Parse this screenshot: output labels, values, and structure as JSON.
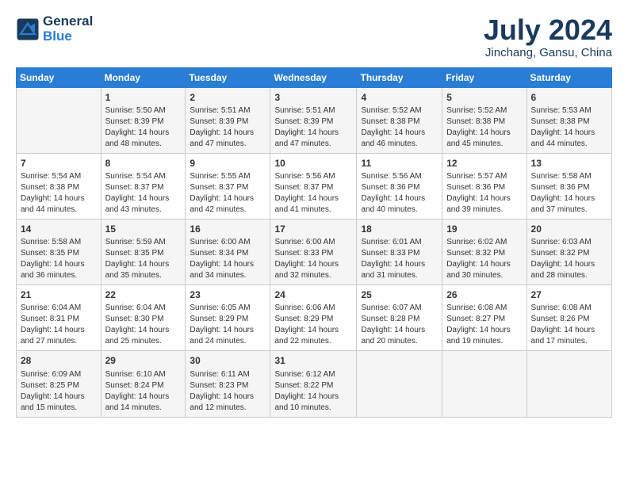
{
  "logo": {
    "line1": "General",
    "line2": "Blue"
  },
  "title": "July 2024",
  "location": "Jinchang, Gansu, China",
  "weekdays": [
    "Sunday",
    "Monday",
    "Tuesday",
    "Wednesday",
    "Thursday",
    "Friday",
    "Saturday"
  ],
  "weeks": [
    [
      {
        "day": "",
        "info": ""
      },
      {
        "day": "1",
        "info": "Sunrise: 5:50 AM\nSunset: 8:39 PM\nDaylight: 14 hours\nand 48 minutes."
      },
      {
        "day": "2",
        "info": "Sunrise: 5:51 AM\nSunset: 8:39 PM\nDaylight: 14 hours\nand 47 minutes."
      },
      {
        "day": "3",
        "info": "Sunrise: 5:51 AM\nSunset: 8:39 PM\nDaylight: 14 hours\nand 47 minutes."
      },
      {
        "day": "4",
        "info": "Sunrise: 5:52 AM\nSunset: 8:38 PM\nDaylight: 14 hours\nand 46 minutes."
      },
      {
        "day": "5",
        "info": "Sunrise: 5:52 AM\nSunset: 8:38 PM\nDaylight: 14 hours\nand 45 minutes."
      },
      {
        "day": "6",
        "info": "Sunrise: 5:53 AM\nSunset: 8:38 PM\nDaylight: 14 hours\nand 44 minutes."
      }
    ],
    [
      {
        "day": "7",
        "info": "Sunrise: 5:54 AM\nSunset: 8:38 PM\nDaylight: 14 hours\nand 44 minutes."
      },
      {
        "day": "8",
        "info": "Sunrise: 5:54 AM\nSunset: 8:37 PM\nDaylight: 14 hours\nand 43 minutes."
      },
      {
        "day": "9",
        "info": "Sunrise: 5:55 AM\nSunset: 8:37 PM\nDaylight: 14 hours\nand 42 minutes."
      },
      {
        "day": "10",
        "info": "Sunrise: 5:56 AM\nSunset: 8:37 PM\nDaylight: 14 hours\nand 41 minutes."
      },
      {
        "day": "11",
        "info": "Sunrise: 5:56 AM\nSunset: 8:36 PM\nDaylight: 14 hours\nand 40 minutes."
      },
      {
        "day": "12",
        "info": "Sunrise: 5:57 AM\nSunset: 8:36 PM\nDaylight: 14 hours\nand 39 minutes."
      },
      {
        "day": "13",
        "info": "Sunrise: 5:58 AM\nSunset: 8:36 PM\nDaylight: 14 hours\nand 37 minutes."
      }
    ],
    [
      {
        "day": "14",
        "info": "Sunrise: 5:58 AM\nSunset: 8:35 PM\nDaylight: 14 hours\nand 36 minutes."
      },
      {
        "day": "15",
        "info": "Sunrise: 5:59 AM\nSunset: 8:35 PM\nDaylight: 14 hours\nand 35 minutes."
      },
      {
        "day": "16",
        "info": "Sunrise: 6:00 AM\nSunset: 8:34 PM\nDaylight: 14 hours\nand 34 minutes."
      },
      {
        "day": "17",
        "info": "Sunrise: 6:00 AM\nSunset: 8:33 PM\nDaylight: 14 hours\nand 32 minutes."
      },
      {
        "day": "18",
        "info": "Sunrise: 6:01 AM\nSunset: 8:33 PM\nDaylight: 14 hours\nand 31 minutes."
      },
      {
        "day": "19",
        "info": "Sunrise: 6:02 AM\nSunset: 8:32 PM\nDaylight: 14 hours\nand 30 minutes."
      },
      {
        "day": "20",
        "info": "Sunrise: 6:03 AM\nSunset: 8:32 PM\nDaylight: 14 hours\nand 28 minutes."
      }
    ],
    [
      {
        "day": "21",
        "info": "Sunrise: 6:04 AM\nSunset: 8:31 PM\nDaylight: 14 hours\nand 27 minutes."
      },
      {
        "day": "22",
        "info": "Sunrise: 6:04 AM\nSunset: 8:30 PM\nDaylight: 14 hours\nand 25 minutes."
      },
      {
        "day": "23",
        "info": "Sunrise: 6:05 AM\nSunset: 8:29 PM\nDaylight: 14 hours\nand 24 minutes."
      },
      {
        "day": "24",
        "info": "Sunrise: 6:06 AM\nSunset: 8:29 PM\nDaylight: 14 hours\nand 22 minutes."
      },
      {
        "day": "25",
        "info": "Sunrise: 6:07 AM\nSunset: 8:28 PM\nDaylight: 14 hours\nand 20 minutes."
      },
      {
        "day": "26",
        "info": "Sunrise: 6:08 AM\nSunset: 8:27 PM\nDaylight: 14 hours\nand 19 minutes."
      },
      {
        "day": "27",
        "info": "Sunrise: 6:08 AM\nSunset: 8:26 PM\nDaylight: 14 hours\nand 17 minutes."
      }
    ],
    [
      {
        "day": "28",
        "info": "Sunrise: 6:09 AM\nSunset: 8:25 PM\nDaylight: 14 hours\nand 15 minutes."
      },
      {
        "day": "29",
        "info": "Sunrise: 6:10 AM\nSunset: 8:24 PM\nDaylight: 14 hours\nand 14 minutes."
      },
      {
        "day": "30",
        "info": "Sunrise: 6:11 AM\nSunset: 8:23 PM\nDaylight: 14 hours\nand 12 minutes."
      },
      {
        "day": "31",
        "info": "Sunrise: 6:12 AM\nSunset: 8:22 PM\nDaylight: 14 hours\nand 10 minutes."
      },
      {
        "day": "",
        "info": ""
      },
      {
        "day": "",
        "info": ""
      },
      {
        "day": "",
        "info": ""
      }
    ]
  ]
}
